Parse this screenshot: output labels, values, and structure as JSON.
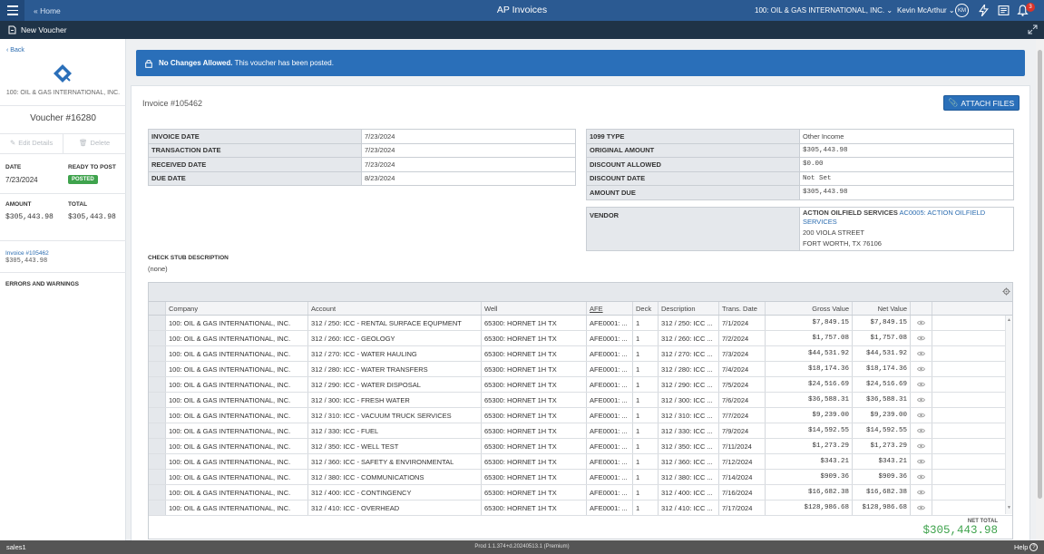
{
  "topbar": {
    "home_link": "« Home",
    "title": "AP Invoices",
    "company": "100: OIL & GAS INTERNATIONAL, INC.",
    "user": "Kevin McArthur",
    "avatar_initials": "KM",
    "notifications_count": "3"
  },
  "subbar": {
    "new_voucher": "New Voucher"
  },
  "sidebar": {
    "back": "Back",
    "company": "100: OIL & GAS INTERNATIONAL, INC.",
    "voucher_title": "Voucher #16280",
    "edit_details": "Edit Details",
    "delete": "Delete",
    "date_label": "DATE",
    "date_value": "7/23/2024",
    "status_label": "READY TO POST",
    "status_badge": "POSTED",
    "amount_label": "AMOUNT",
    "amount_value": "$305,443.98",
    "total_label": "TOTAL",
    "total_value": "$305,443.98",
    "invoice_link": "Invoice #105462",
    "invoice_amount": "$305,443.98",
    "errors_label": "ERRORS AND WARNINGS"
  },
  "notice": {
    "bold": "No Changes Allowed.",
    "text": " This voucher has been posted."
  },
  "invoice": {
    "title": "Invoice #105462",
    "attach_button": "ATTACH FILES",
    "dates": [
      {
        "label": "INVOICE DATE",
        "value": "7/23/2024"
      },
      {
        "label": "TRANSACTION DATE",
        "value": "7/23/2024"
      },
      {
        "label": "RECEIVED DATE",
        "value": "7/23/2024"
      },
      {
        "label": "DUE DATE",
        "value": "8/23/2024"
      }
    ],
    "amounts": [
      {
        "label": "1099 TYPE",
        "value": "Other Income"
      },
      {
        "label": "ORIGINAL AMOUNT",
        "value": "$305,443.98"
      },
      {
        "label": "DISCOUNT ALLOWED",
        "value": "$0.00"
      },
      {
        "label": "DISCOUNT DATE",
        "value": "Not Set"
      },
      {
        "label": "AMOUNT DUE",
        "value": "$305,443.98"
      }
    ],
    "vendor": {
      "label": "VENDOR",
      "name": "ACTION OILFIELD SERVICES",
      "link": "AC0005: ACTION OILFIELD SERVICES",
      "street": "200 VIOLA STREET",
      "city": "FORT WORTH, TX 76106"
    },
    "stub_label": "CHECK STUB DESCRIPTION",
    "stub_value": "(none)"
  },
  "grid": {
    "columns": [
      "Company",
      "Account",
      "Well",
      "AFE",
      "Deck",
      "Description",
      "Trans. Date",
      "Gross Value",
      "Net Value"
    ],
    "rows": [
      {
        "company": "100: OIL & GAS INTERNATIONAL, INC.",
        "account": "312 / 250: ICC - RENTAL SURFACE EQUPMENT",
        "well": "65300: HORNET 1H TX",
        "afe": "AFE0001: ...",
        "deck": "1",
        "desc": "312 / 250: ICC ...",
        "date": "7/1/2024",
        "gross": "$7,849.15",
        "net": "$7,849.15"
      },
      {
        "company": "100: OIL & GAS INTERNATIONAL, INC.",
        "account": "312 / 260: ICC - GEOLOGY",
        "well": "65300: HORNET 1H TX",
        "afe": "AFE0001: ...",
        "deck": "1",
        "desc": "312 / 260: ICC ...",
        "date": "7/2/2024",
        "gross": "$1,757.08",
        "net": "$1,757.08"
      },
      {
        "company": "100: OIL & GAS INTERNATIONAL, INC.",
        "account": "312 / 270: ICC - WATER HAULING",
        "well": "65300: HORNET 1H TX",
        "afe": "AFE0001: ...",
        "deck": "1",
        "desc": "312 / 270: ICC ...",
        "date": "7/3/2024",
        "gross": "$44,531.92",
        "net": "$44,531.92"
      },
      {
        "company": "100: OIL & GAS INTERNATIONAL, INC.",
        "account": "312 / 280: ICC - WATER TRANSFERS",
        "well": "65300: HORNET 1H TX",
        "afe": "AFE0001: ...",
        "deck": "1",
        "desc": "312 / 280: ICC ...",
        "date": "7/4/2024",
        "gross": "$18,174.36",
        "net": "$18,174.36"
      },
      {
        "company": "100: OIL & GAS INTERNATIONAL, INC.",
        "account": "312 / 290: ICC - WATER DISPOSAL",
        "well": "65300: HORNET 1H TX",
        "afe": "AFE0001: ...",
        "deck": "1",
        "desc": "312 / 290: ICC ...",
        "date": "7/5/2024",
        "gross": "$24,516.69",
        "net": "$24,516.69"
      },
      {
        "company": "100: OIL & GAS INTERNATIONAL, INC.",
        "account": "312 / 300: ICC - FRESH WATER",
        "well": "65300: HORNET 1H TX",
        "afe": "AFE0001: ...",
        "deck": "1",
        "desc": "312 / 300: ICC ...",
        "date": "7/6/2024",
        "gross": "$36,588.31",
        "net": "$36,588.31"
      },
      {
        "company": "100: OIL & GAS INTERNATIONAL, INC.",
        "account": "312 / 310: ICC - VACUUM TRUCK SERVICES",
        "well": "65300: HORNET 1H TX",
        "afe": "AFE0001: ...",
        "deck": "1",
        "desc": "312 / 310: ICC ...",
        "date": "7/7/2024",
        "gross": "$9,239.00",
        "net": "$9,239.00"
      },
      {
        "company": "100: OIL & GAS INTERNATIONAL, INC.",
        "account": "312 / 330: ICC - FUEL",
        "well": "65300: HORNET 1H TX",
        "afe": "AFE0001: ...",
        "deck": "1",
        "desc": "312 / 330: ICC ...",
        "date": "7/9/2024",
        "gross": "$14,592.55",
        "net": "$14,592.55"
      },
      {
        "company": "100: OIL & GAS INTERNATIONAL, INC.",
        "account": "312 / 350: ICC - WELL TEST",
        "well": "65300: HORNET 1H TX",
        "afe": "AFE0001: ...",
        "deck": "1",
        "desc": "312 / 350: ICC ...",
        "date": "7/11/2024",
        "gross": "$1,273.29",
        "net": "$1,273.29"
      },
      {
        "company": "100: OIL & GAS INTERNATIONAL, INC.",
        "account": "312 / 360: ICC - SAFETY & ENVIRONMENTAL",
        "well": "65300: HORNET 1H TX",
        "afe": "AFE0001: ...",
        "deck": "1",
        "desc": "312 / 360: ICC ...",
        "date": "7/12/2024",
        "gross": "$343.21",
        "net": "$343.21"
      },
      {
        "company": "100: OIL & GAS INTERNATIONAL, INC.",
        "account": "312 / 380: ICC - COMMUNICATIONS",
        "well": "65300: HORNET 1H TX",
        "afe": "AFE0001: ...",
        "deck": "1",
        "desc": "312 / 380: ICC ...",
        "date": "7/14/2024",
        "gross": "$909.36",
        "net": "$909.36"
      },
      {
        "company": "100: OIL & GAS INTERNATIONAL, INC.",
        "account": "312 / 400: ICC - CONTINGENCY",
        "well": "65300: HORNET 1H TX",
        "afe": "AFE0001: ...",
        "deck": "1",
        "desc": "312 / 400: ICC ...",
        "date": "7/16/2024",
        "gross": "$16,682.38",
        "net": "$16,682.38"
      },
      {
        "company": "100: OIL & GAS INTERNATIONAL, INC.",
        "account": "312 / 410: ICC - OVERHEAD",
        "well": "65300: HORNET 1H TX",
        "afe": "AFE0001: ...",
        "deck": "1",
        "desc": "312 / 410: ICC ...",
        "date": "7/17/2024",
        "gross": "$128,986.68",
        "net": "$128,986.68"
      }
    ],
    "net_total_label": "NET TOTAL",
    "net_total_value": "$305,443.98"
  },
  "footer": {
    "user": "sales1",
    "build": "Prod 1.1.374+d.20240513.1 (Premium)",
    "help": "Help"
  },
  "colors": {
    "topbar": "#2b5a92",
    "subbar": "#1f3347",
    "accent": "#2a6fb9",
    "posted": "#3fa34d",
    "footer": "#555555"
  }
}
